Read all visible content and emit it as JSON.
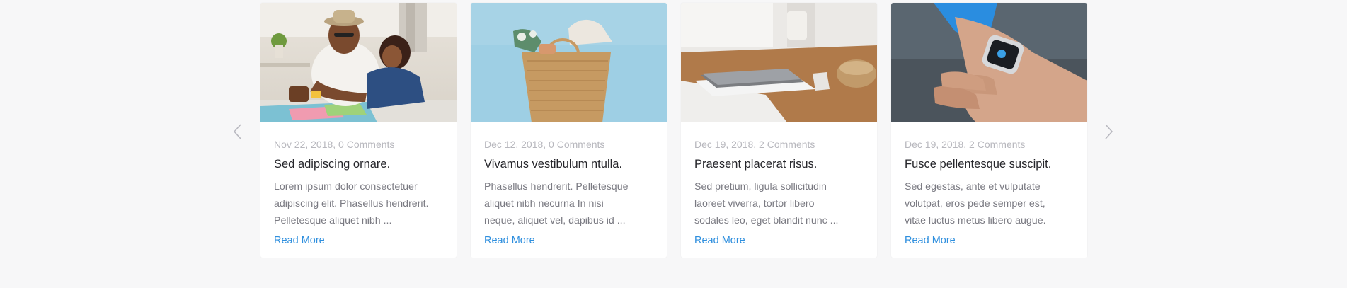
{
  "carousel": {
    "prev_icon": "chevron-left-icon",
    "next_icon": "chevron-right-icon",
    "arrow_color": "#b9b9c0"
  },
  "cards": [
    {
      "meta": "Nov 22, 2018, 0 Comments",
      "title": "Sed adipiscing ornare.",
      "excerpt_lines": [
        "Lorem ipsum dolor consectetuer",
        "adipiscing elit. Phasellus hendrerit.",
        "Pelletesque aliquet nibh ..."
      ],
      "link": "Read More",
      "image": "father-daughter-drawing-photo"
    },
    {
      "meta": "Dec 12, 2018, 0 Comments",
      "title": "Vivamus vestibulum ntulla.",
      "excerpt_lines": [
        "Phasellus hendrerit. Pelletesque",
        "aliquet nibh necurna In nisi",
        "neque, aliquet vel, dapibus id ..."
      ],
      "link": "Read More",
      "image": "wicker-bag-photo"
    },
    {
      "meta": "Dec 19, 2018, 2 Comments",
      "title": "Praesent placerat risus.",
      "excerpt_lines": [
        "Sed pretium, ligula sollicitudin",
        "laoreet viverra, tortor libero",
        "sodales leo, eget blandit nunc ..."
      ],
      "link": "Read More",
      "image": "laptop-on-desk-photo"
    },
    {
      "meta": "Dec 19, 2018, 2 Comments",
      "title": "Fusce pellentesque suscipit.",
      "excerpt_lines": [
        "Sed egestas, ante et vulputate",
        "volutpat, eros pede semper est,",
        "vitae luctus metus libero augue."
      ],
      "link": "Read More",
      "image": "smartwatch-photo"
    }
  ],
  "colors": {
    "background": "#f7f7f8",
    "card": "#ffffff",
    "meta": "#b7b7bd",
    "title": "#26262b",
    "excerpt": "#7a7a82",
    "link": "#2f8fde"
  }
}
